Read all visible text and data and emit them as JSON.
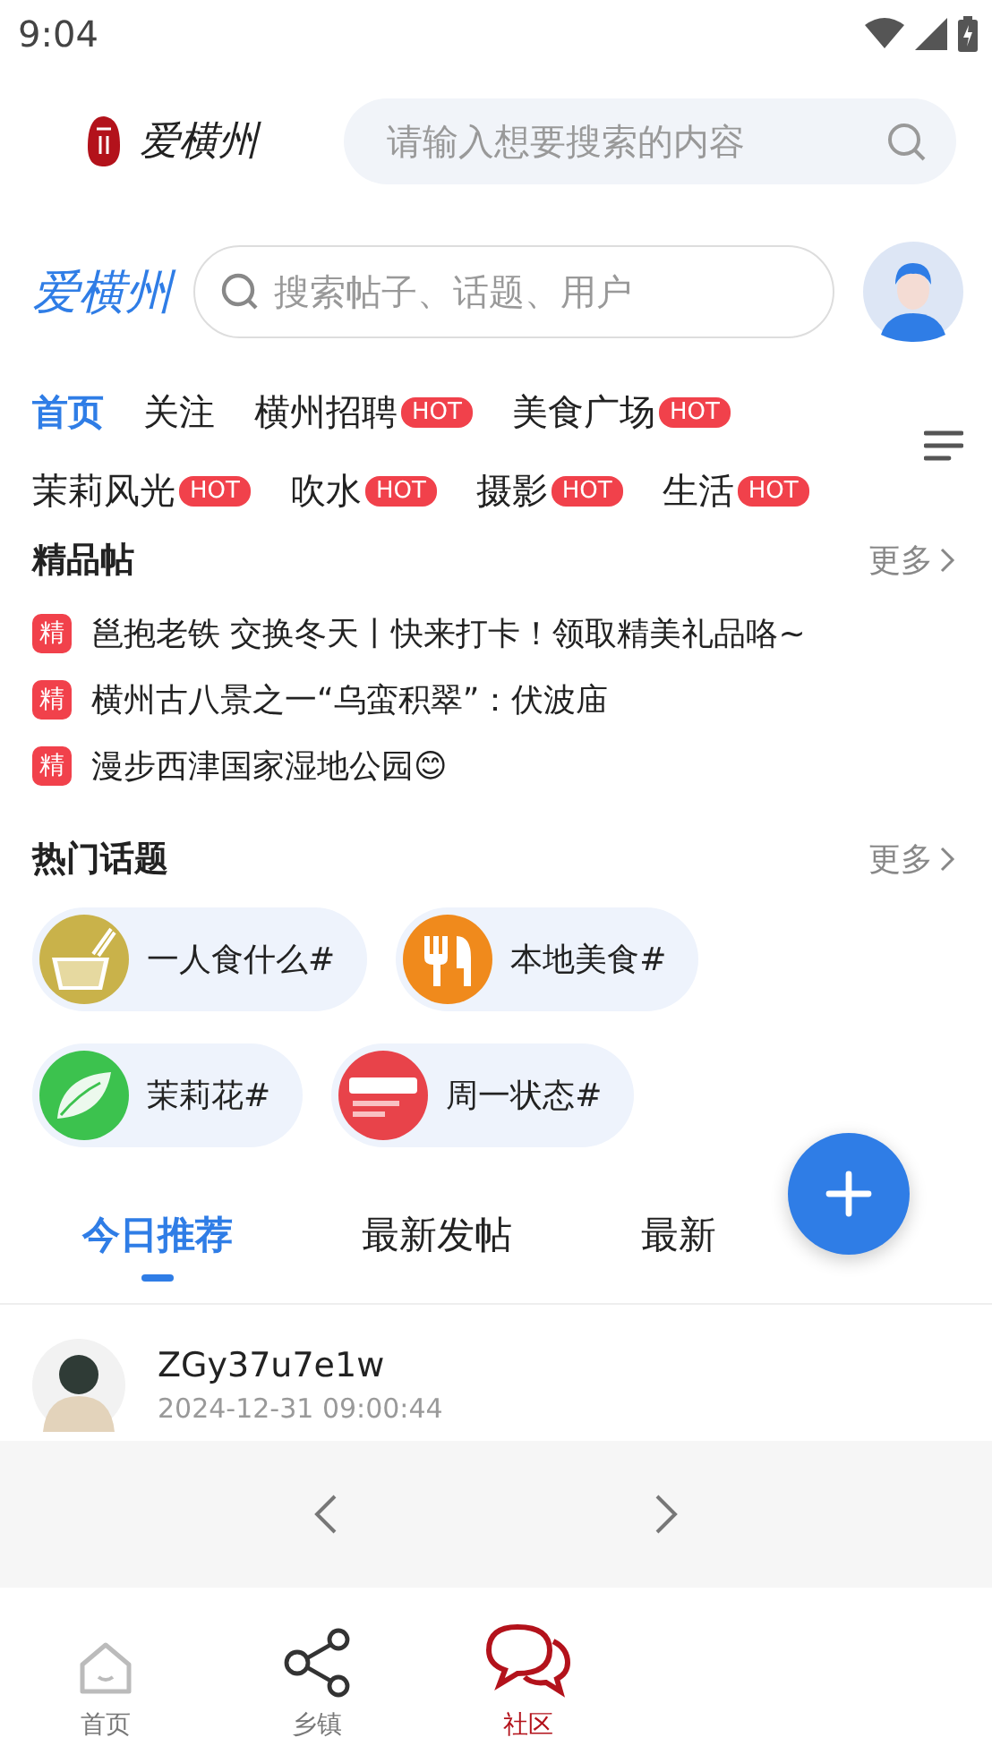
{
  "status_bar": {
    "time": "9:04"
  },
  "header": {
    "logo_text": "爱横州",
    "search": {
      "placeholder": "请输入想要搜索的内容"
    }
  },
  "community_bar": {
    "title": "爱横州",
    "search": {
      "placeholder": "搜索帖子、话题、用户"
    }
  },
  "categories": [
    {
      "label": "首页",
      "selected": true
    },
    {
      "label": "关注",
      "selected": false
    },
    {
      "label": "横州招聘",
      "selected": false,
      "badge": "HOT"
    },
    {
      "label": "美食广场",
      "selected": false,
      "badge": "HOT"
    },
    {
      "label": "茉莉风光",
      "selected": false,
      "badge": "HOT"
    },
    {
      "label": "吹水",
      "selected": false,
      "badge": "HOT"
    },
    {
      "label": "摄影",
      "selected": false,
      "badge": "HOT"
    },
    {
      "label": "生活",
      "selected": false,
      "badge": "HOT"
    }
  ],
  "featured": {
    "title": "精品帖",
    "more": "更多",
    "posts": [
      {
        "badge": "精",
        "text": "邕抱老铁 交换冬天丨快来打卡！领取精美礼品咯~"
      },
      {
        "badge": "精",
        "text": "横州古八景之一“乌蛮积翠”：伏波庙"
      },
      {
        "badge": "精",
        "text": "漫步西津国家湿地公园😊"
      }
    ]
  },
  "topics": {
    "title": "热门话题",
    "more": "更多",
    "items": [
      {
        "label": "一人食什么#",
        "kind": "bowl",
        "color": "#c9b24a"
      },
      {
        "label": "本地美食#",
        "kind": "cutlery",
        "color": "#f08a1c"
      },
      {
        "label": "茉莉花#",
        "kind": "leaf",
        "color": "#3cc24e"
      },
      {
        "label": "周一状态#",
        "kind": "calendar",
        "color": "#e8434a"
      }
    ]
  },
  "feed_tabs": [
    {
      "label": "今日推荐",
      "selected": true
    },
    {
      "label": "最新发帖",
      "selected": false
    },
    {
      "label": "最新",
      "selected": false
    }
  ],
  "post": {
    "author": "ZGy37u7e1w",
    "time": "2024-12-31 09:00:44"
  },
  "bottom_nav": [
    {
      "label": "首页",
      "kind": "home",
      "selected": false
    },
    {
      "label": "乡镇",
      "kind": "share",
      "selected": false
    },
    {
      "label": "社区",
      "kind": "chat",
      "selected": true
    }
  ]
}
